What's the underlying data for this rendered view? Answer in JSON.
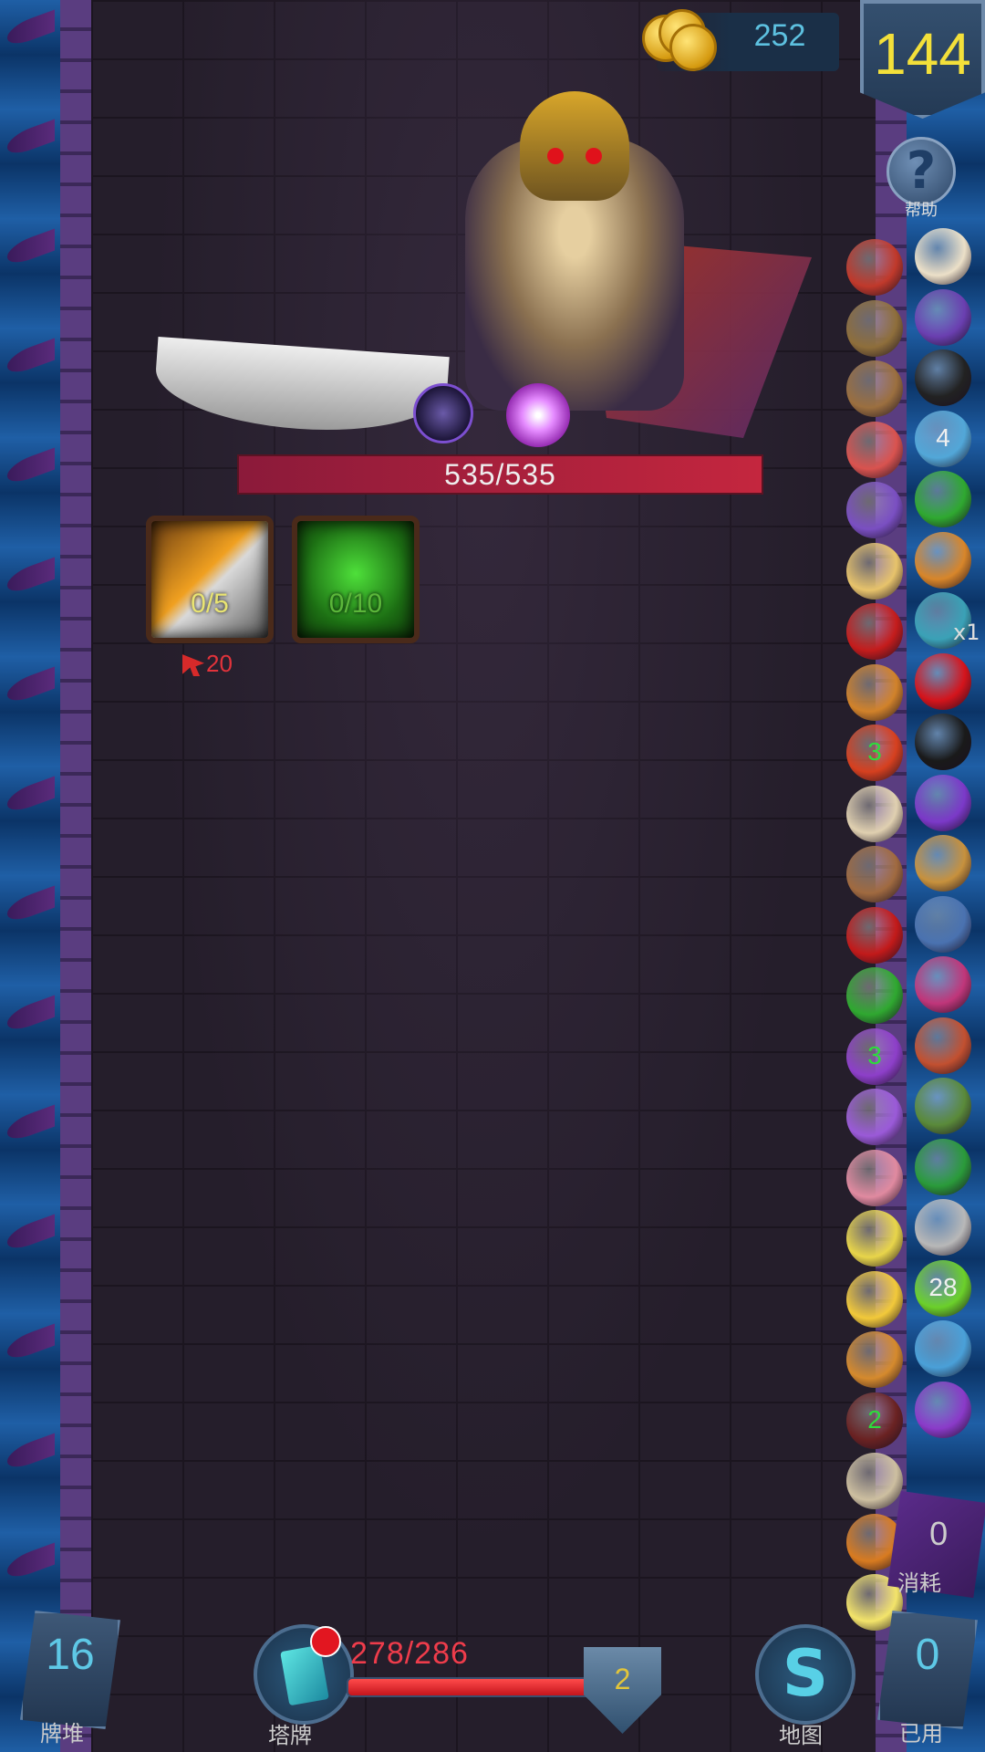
{
  "header": {
    "coins": "252",
    "floor": "144",
    "help_label": "帮助"
  },
  "enemy": {
    "hp_text": "535/535",
    "intents": [
      {
        "icon": "slash-attack-icon",
        "count": "0/5"
      },
      {
        "icon": "poison-slime-icon",
        "count": "0/10"
      }
    ],
    "damage": "20"
  },
  "relics": {
    "left_column": [
      {
        "icon": "sock-icon"
      },
      {
        "icon": "bullet-icon"
      },
      {
        "icon": "sack-icon"
      },
      {
        "icon": "target-icon"
      },
      {
        "icon": "purple-eye-icon"
      },
      {
        "icon": "envelope-icon"
      },
      {
        "icon": "rose-icon"
      },
      {
        "icon": "fruit-bowl-icon"
      },
      {
        "icon": "fire-orb-icon",
        "count": "3"
      },
      {
        "icon": "card-icon"
      },
      {
        "icon": "vial-icon"
      },
      {
        "icon": "rose-icon"
      },
      {
        "icon": "clover-icon"
      },
      {
        "icon": "purple-rune-icon",
        "count": "3"
      },
      {
        "icon": "purple-sigil-icon"
      },
      {
        "icon": "swirl-icon"
      },
      {
        "icon": "yellow-eye-icon"
      },
      {
        "icon": "cheese-icon"
      },
      {
        "icon": "bread-icon"
      },
      {
        "icon": "twig-icon",
        "count": "2"
      },
      {
        "icon": "scroll-icon"
      },
      {
        "icon": "amber-egg-icon"
      },
      {
        "icon": "yellow-glyph-icon"
      }
    ],
    "right_column": [
      {
        "icon": "dice-icon"
      },
      {
        "icon": "witch-hat-icon"
      },
      {
        "icon": "triquetra-icon"
      },
      {
        "icon": "blue-gem-icon",
        "count": "4"
      },
      {
        "icon": "green-claw-icon"
      },
      {
        "icon": "fire-pot-icon"
      },
      {
        "icon": "blue-spiral-icon",
        "multiplier": "x1"
      },
      {
        "icon": "blood-drop-icon"
      },
      {
        "icon": "black-orb-icon"
      },
      {
        "icon": "dark-flame-icon"
      },
      {
        "icon": "scroll-icon"
      },
      {
        "icon": "can-icon"
      },
      {
        "icon": "pink-gem-icon"
      },
      {
        "icon": "meteor-icon"
      },
      {
        "icon": "green-book-icon"
      },
      {
        "icon": "green-card-icon"
      },
      {
        "icon": "gauntlet-icon"
      },
      {
        "icon": "green-sigil-icon",
        "count": "28"
      },
      {
        "icon": "blue-flame-icon"
      },
      {
        "icon": "dagger-icon"
      }
    ]
  },
  "bottom": {
    "draw_pile": {
      "count": "16",
      "label": "牌堆"
    },
    "deck": {
      "label": "塔牌"
    },
    "player_hp": "278/286",
    "player_hp_fraction": 0.972,
    "armor": "2",
    "map": {
      "label": "地图"
    },
    "consumed": {
      "count": "0",
      "label": "消耗"
    },
    "discard": {
      "count": "0",
      "label": "已用"
    }
  },
  "colors": {
    "hp_red": "#c4263e",
    "coin_text": "#5dc1e0",
    "floor_text": "#f3e03a"
  }
}
